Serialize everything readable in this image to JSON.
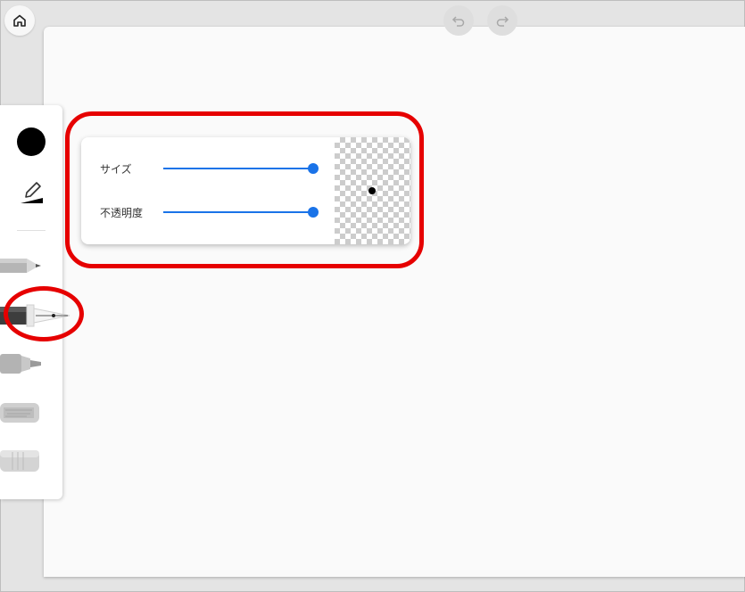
{
  "header": {
    "home_icon": "home-icon",
    "undo_icon": "undo-icon",
    "redo_icon": "redo-icon"
  },
  "toolbar": {
    "current_color": "#000000",
    "tools": [
      {
        "name": "pencil",
        "icon": "pencil-tool-icon",
        "selected": false
      },
      {
        "name": "fountain-pen",
        "icon": "fountain-pen-tool-icon",
        "selected": true
      },
      {
        "name": "marker",
        "icon": "marker-tool-icon",
        "selected": false
      },
      {
        "name": "crayon",
        "icon": "crayon-tool-icon",
        "selected": false
      },
      {
        "name": "eraser",
        "icon": "eraser-tool-icon",
        "selected": false
      }
    ]
  },
  "brush_popup": {
    "size_label": "サイズ",
    "size_value": 1.0,
    "opacity_label": "不透明度",
    "opacity_value": 1.0,
    "accent_color": "#1a73e8",
    "preview_color": "#000000"
  },
  "annotation_color": "#e60000"
}
